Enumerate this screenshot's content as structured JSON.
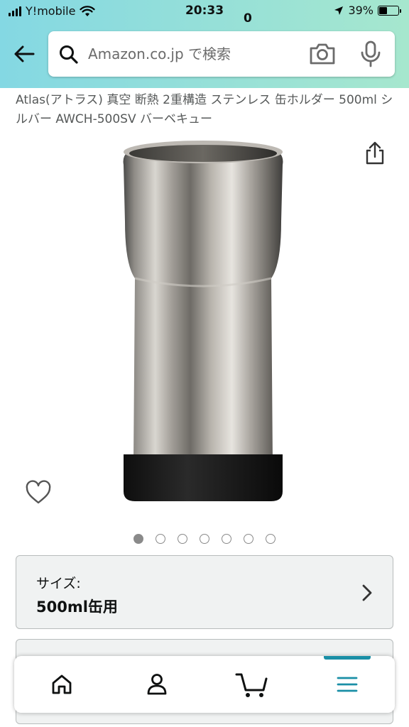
{
  "status_bar": {
    "carrier": "Y!mobile",
    "time": "20:33",
    "battery": "39%",
    "battery_level": 0.39
  },
  "search": {
    "placeholder": "Amazon.co.jp で検索",
    "value": ""
  },
  "product": {
    "title": "Atlas(アトラス) 真空 断熱 2重構造 ステンレス 缶ホルダー 500ml シルバー AWCH-500SV バーベキュー",
    "image_count": 7,
    "active_image_index": 0
  },
  "size_selector": {
    "label": "サイズ:",
    "value": "500ml缶用"
  },
  "bottom_nav": {
    "cart_count": "0",
    "active_tab": "menu"
  },
  "colors": {
    "header_gradient_start": "#84d8e3",
    "header_gradient_end": "#a6e7ce",
    "accent": "#1a8fa6"
  }
}
